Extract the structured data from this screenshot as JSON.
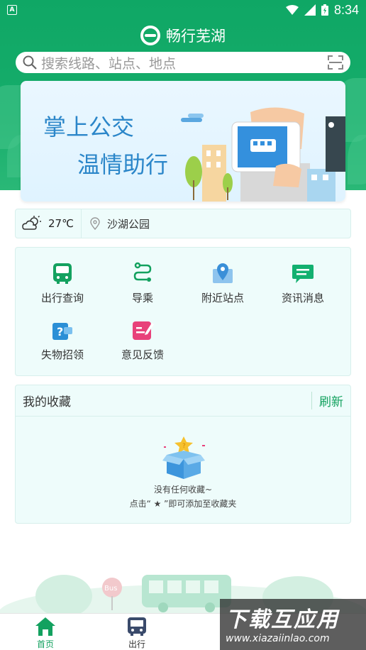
{
  "status_bar": {
    "time": "8:34",
    "left_badge": "A"
  },
  "app": {
    "title": "畅行芜湖"
  },
  "search": {
    "placeholder": "搜索线路、站点、地点"
  },
  "banner": {
    "line1": "掌上公交",
    "line2": "温情助行"
  },
  "weather": {
    "temperature": "27℃",
    "location": "沙湖公园"
  },
  "features": [
    {
      "label": "出行查询",
      "icon": "bus-icon",
      "color": "#13a15f"
    },
    {
      "label": "导乘",
      "icon": "route-icon",
      "color": "#13a15f"
    },
    {
      "label": "附近站点",
      "icon": "map-pin-icon",
      "color": "#3a8fd8"
    },
    {
      "label": "资讯消息",
      "icon": "message-icon",
      "color": "#13b070"
    },
    {
      "label": "失物招领",
      "icon": "wallet-question-icon",
      "color": "#2b8fd6"
    },
    {
      "label": "意见反馈",
      "icon": "edit-icon",
      "color": "#e8417a"
    }
  ],
  "favorites": {
    "title": "我的收藏",
    "refresh": "刷新",
    "empty_line1": "没有任何收藏~",
    "empty_line2": "点击“ ★ ”即可添加至收藏夹"
  },
  "bottom_art": {
    "bus_sign": "Bus"
  },
  "tabs": [
    {
      "label": "首页",
      "active": true
    },
    {
      "label": "出行",
      "active": false
    }
  ],
  "watermark": {
    "line1": "下载互应用",
    "line2": "www.xiazaiinlao.com"
  },
  "colors": {
    "primary": "#0fa765",
    "panel_bg": "#eefcfb",
    "accent_blue": "#2b86c9"
  }
}
